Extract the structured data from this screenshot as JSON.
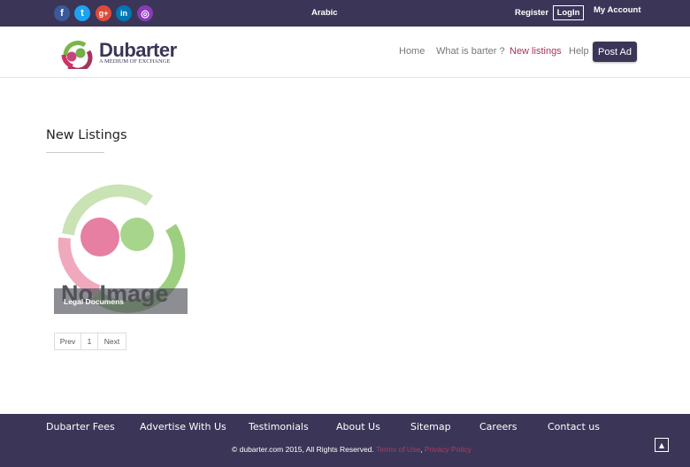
{
  "colors": {
    "brand_dark": "#3b3657",
    "brand_pink": "#a6355d",
    "facebook": "#3b5998",
    "twitter": "#1da1f2",
    "googleplus": "#dd4b39",
    "linkedin": "#0077b5",
    "instagram": "#8a3ab9"
  },
  "topbar": {
    "social": [
      {
        "name": "facebook-icon",
        "glyph": "f"
      },
      {
        "name": "twitter-icon",
        "glyph": "t"
      },
      {
        "name": "google-plus-icon",
        "glyph": "g+"
      },
      {
        "name": "linkedin-icon",
        "glyph": "in"
      },
      {
        "name": "instagram-icon",
        "glyph": "◎"
      }
    ],
    "language": "Arabic",
    "register": "Register",
    "login": "LogIn",
    "my_account": "My Account"
  },
  "header": {
    "logo_word": "Dubarter",
    "logo_tagline": "A MEDIUM OF EXCHANGE",
    "nav": {
      "home": "Home",
      "what_is_barter": "What is barter ?",
      "new_listings": "New listings",
      "help": "Help",
      "post_ad": "Post Ad"
    }
  },
  "main": {
    "title": "New Listings",
    "listings": [
      {
        "label": "Legal Documens",
        "placeholder_text": "No Image"
      }
    ],
    "pagination": {
      "prev": "Prev",
      "page": "1",
      "next": "Next"
    }
  },
  "footer": {
    "links": {
      "fees": "Dubarter Fees",
      "advertise": "Advertise With Us",
      "testimonials": "Testimonials",
      "about": "About Us",
      "sitemap": "Sitemap",
      "careers": "Careers",
      "contact": "Contact us"
    },
    "copyright": "© dubarter.com 2015, All Rights Reserved.",
    "terms": "Terms of Use",
    "privacy": "Privacy Policy",
    "to_top_icon": "chevron-up-icon"
  }
}
